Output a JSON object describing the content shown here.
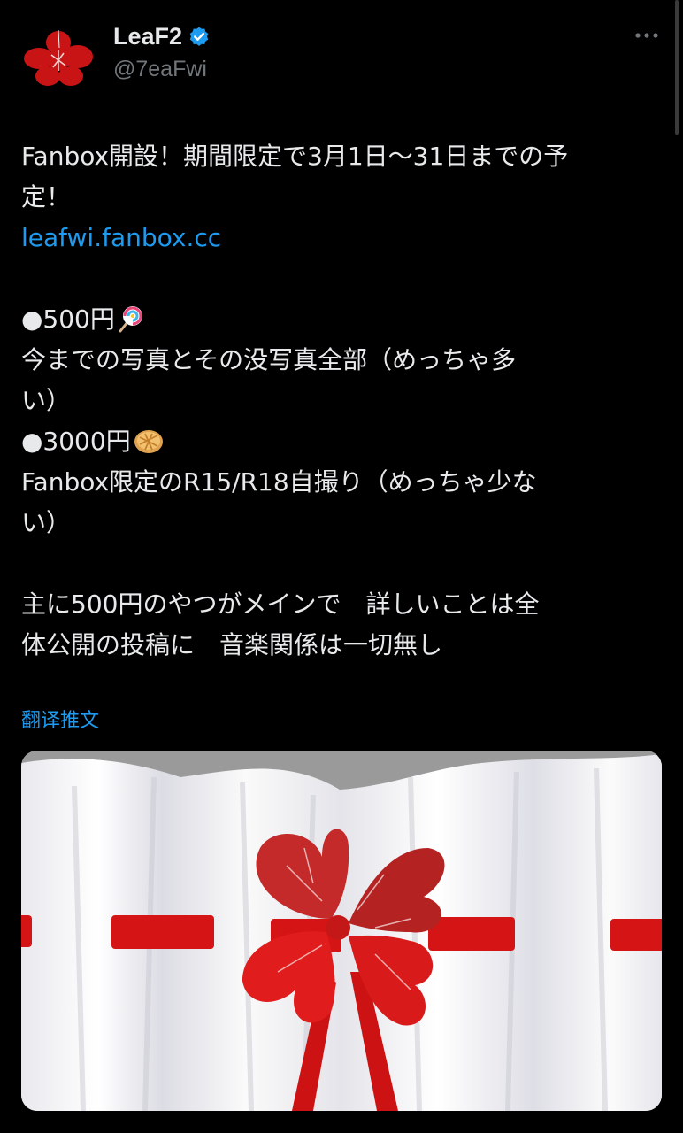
{
  "author": {
    "name": "LeaF2",
    "handle": "@7eaFwi",
    "verified_color": "#1d9bf0",
    "avatar_icon": "red-flower-avatar-icon"
  },
  "more_icon": "more-dots-icon",
  "tweet": {
    "lines": [
      "Fanbox開設！期間限定で3月1日～31日までの予",
      "定！",
      "leafwi.fanbox.cc",
      "",
      "●500円",
      "今までの写真とその没写真全部（めっちゃ多",
      "い）",
      "●3000円",
      "Fanbox限定のR15/R18自撮り（めっちゃ少な",
      "い）",
      "",
      "主に500円のやつがメインで　詳しいことは全",
      "体公開の投稿に　音楽関係は一切無し"
    ],
    "emoji_500": "lollipop-emoji-icon",
    "emoji_3000": "pie-emoji-icon"
  },
  "translate_label": "翻译推文",
  "media": {
    "description_icon": "red-clover-on-white-curtain-image",
    "colors": {
      "red": "#d51515",
      "curtain": "#f2f2f2"
    }
  },
  "colors": {
    "background": "#000000",
    "text": "#e7e9ea",
    "muted": "#71767b",
    "link": "#1d9bf0"
  }
}
